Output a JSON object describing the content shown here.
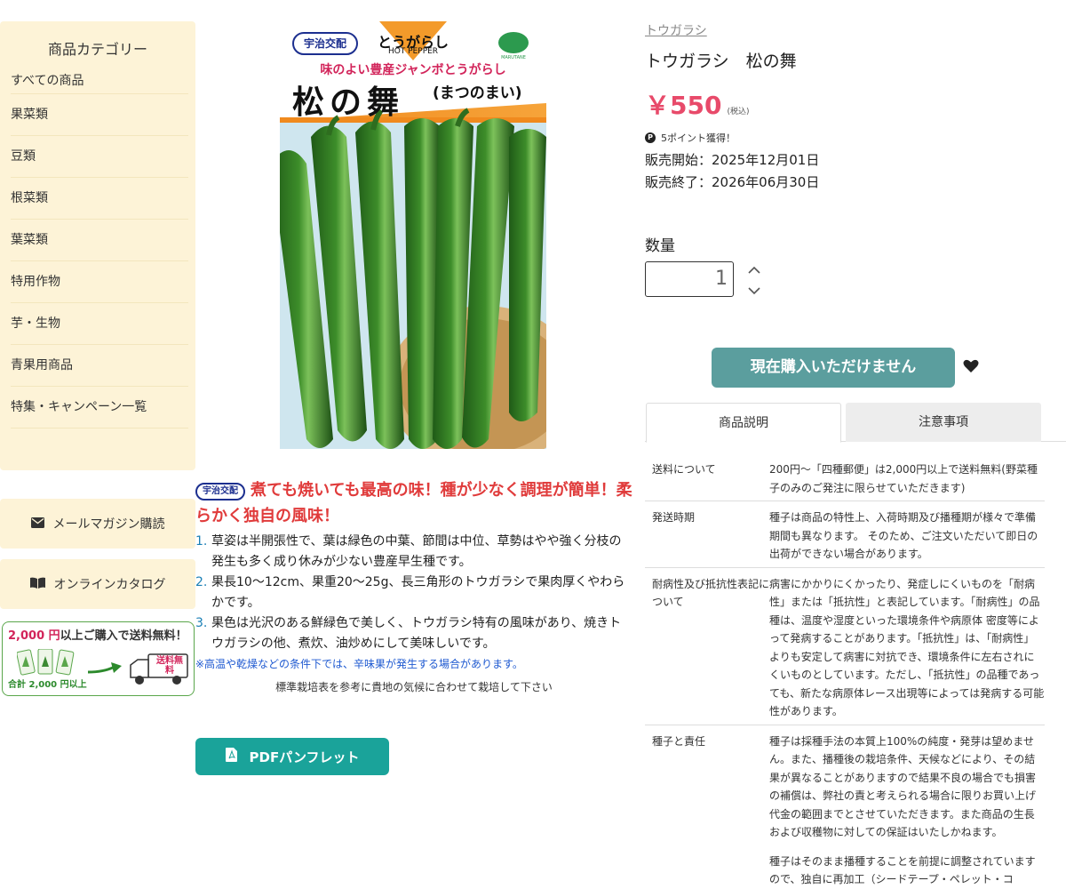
{
  "sidebar": {
    "title": "商品カテゴリー",
    "items": [
      {
        "label": "すべての商品"
      },
      {
        "label": "果菜類"
      },
      {
        "label": "豆類"
      },
      {
        "label": "根菜類"
      },
      {
        "label": "葉菜類"
      },
      {
        "label": "特用作物"
      },
      {
        "label": "芋・生物"
      },
      {
        "label": "青果用商品"
      },
      {
        "label": "特集・キャンペーン一覧"
      }
    ],
    "newsletter_label": "メールマガジン購読",
    "catalog_label": "オンラインカタログ",
    "promo": {
      "amount": "2,000 円",
      "text": "以上ご購入で送料無料！",
      "bottom": "合計 2,000 円以上",
      "truck_text": "送料無料"
    }
  },
  "product_image": {
    "brand_chip": "宇治交配",
    "type_ja": "とうがらし",
    "type_en": "HOT PEPPER",
    "maker": "MARUTANE",
    "tagline": "味のよい豊産ジャンボとうがらし",
    "name": "松の舞",
    "reading": "(まつのまい)"
  },
  "description": {
    "logo_text": "宇治交配",
    "headline": "煮ても焼いても最高の味！種が少なく調理が簡単！柔らかく独自の風味！",
    "points": [
      {
        "num": "1.",
        "text": "草姿は半開張性で、葉は緑色の中葉、節間は中位、草勢はやや強く分枝の発生も多く成り休みが少ない豊産早生種です。"
      },
      {
        "num": "2.",
        "text": "果長10〜12cm、果重20〜25g、長三角形のトウガラシで果肉厚くやわらかです。"
      },
      {
        "num": "3.",
        "text": "果色は光沢のある鮮緑色で美しく、トウガラシ特有の風味があり、焼きトウガラシの他、煮炊、油炒めにして美味しいです。"
      }
    ],
    "note": "※高温や乾燥などの条件下では、辛味果が発生する場合があります。",
    "guide": "標準栽培表を参考に貴地の気候に合わせて栽培して下さい",
    "pdf_label": "PDFパンフレット"
  },
  "product": {
    "breadcrumb": "トウガラシ",
    "title": "トウガラシ　松の舞",
    "price": "￥550",
    "tax": "(税込)",
    "points": "5ポイント獲得！",
    "sale_start": "販売開始：2025年12月01日",
    "sale_end": "販売終了：2026年06月30日",
    "qty_label": "数量",
    "qty_value": "1",
    "buy_label": "現在購入いただけません",
    "tabs": [
      {
        "label": "商品説明"
      },
      {
        "label": "注意事項"
      }
    ],
    "notes": [
      {
        "key": "送料について",
        "val": "200円〜「四種郵便」は2,000円以上で送料無料(野菜種子のみのご発注に限らせていただきます)"
      },
      {
        "key": "発送時期",
        "val": "種子は商品の特性上、入荷時期及び播種期が様々で準備期間も異なります。 そのため、ご注文いただいて即日の出荷ができない場合があります。"
      },
      {
        "key": "耐病性及び抵抗性表記について",
        "val": "病害にかかりにくかったり、発症しにくいものを「耐病性」または「抵抗性」と表記しています。「耐病性」の品種は、温度や湿度といった環境条件や病原体 密度等によって発病することがあります。「抵抗性」は、「耐病性」よりも安定して病害に対抗でき、環境条件に左右されにくいものとしています。ただし、「抵抗性」の品種であっても、新たな病原体レース出現等によっては発病する可能性があります。"
      },
      {
        "key": "種子と責任",
        "val": "種子は採種手法の本質上100%の純度・発芽は望めません。また、播種後の栽培条件、天候などにより、その結果が異なることがありますので結果不良の場合でも損害の補償は、弊社の責と考えられる場合に限りお買い上げ代金の範囲までとさせていただきます。また商品の生長および収穫物に対しての保証はいたしかねます。"
      },
      {
        "key": "",
        "val": "種子はそのまま播種することを前提に調整されていますので、独自に再加工（シードテープ・ペレット・コ"
      }
    ]
  },
  "colors": {
    "sidebar_bg": "#fdf3d7",
    "price": "#e84a6a",
    "buy_button": "#5b9e9e",
    "pdf_button": "#1aa39a",
    "headline_red": "#e03b3b",
    "note_blue": "#1f5ad1"
  }
}
